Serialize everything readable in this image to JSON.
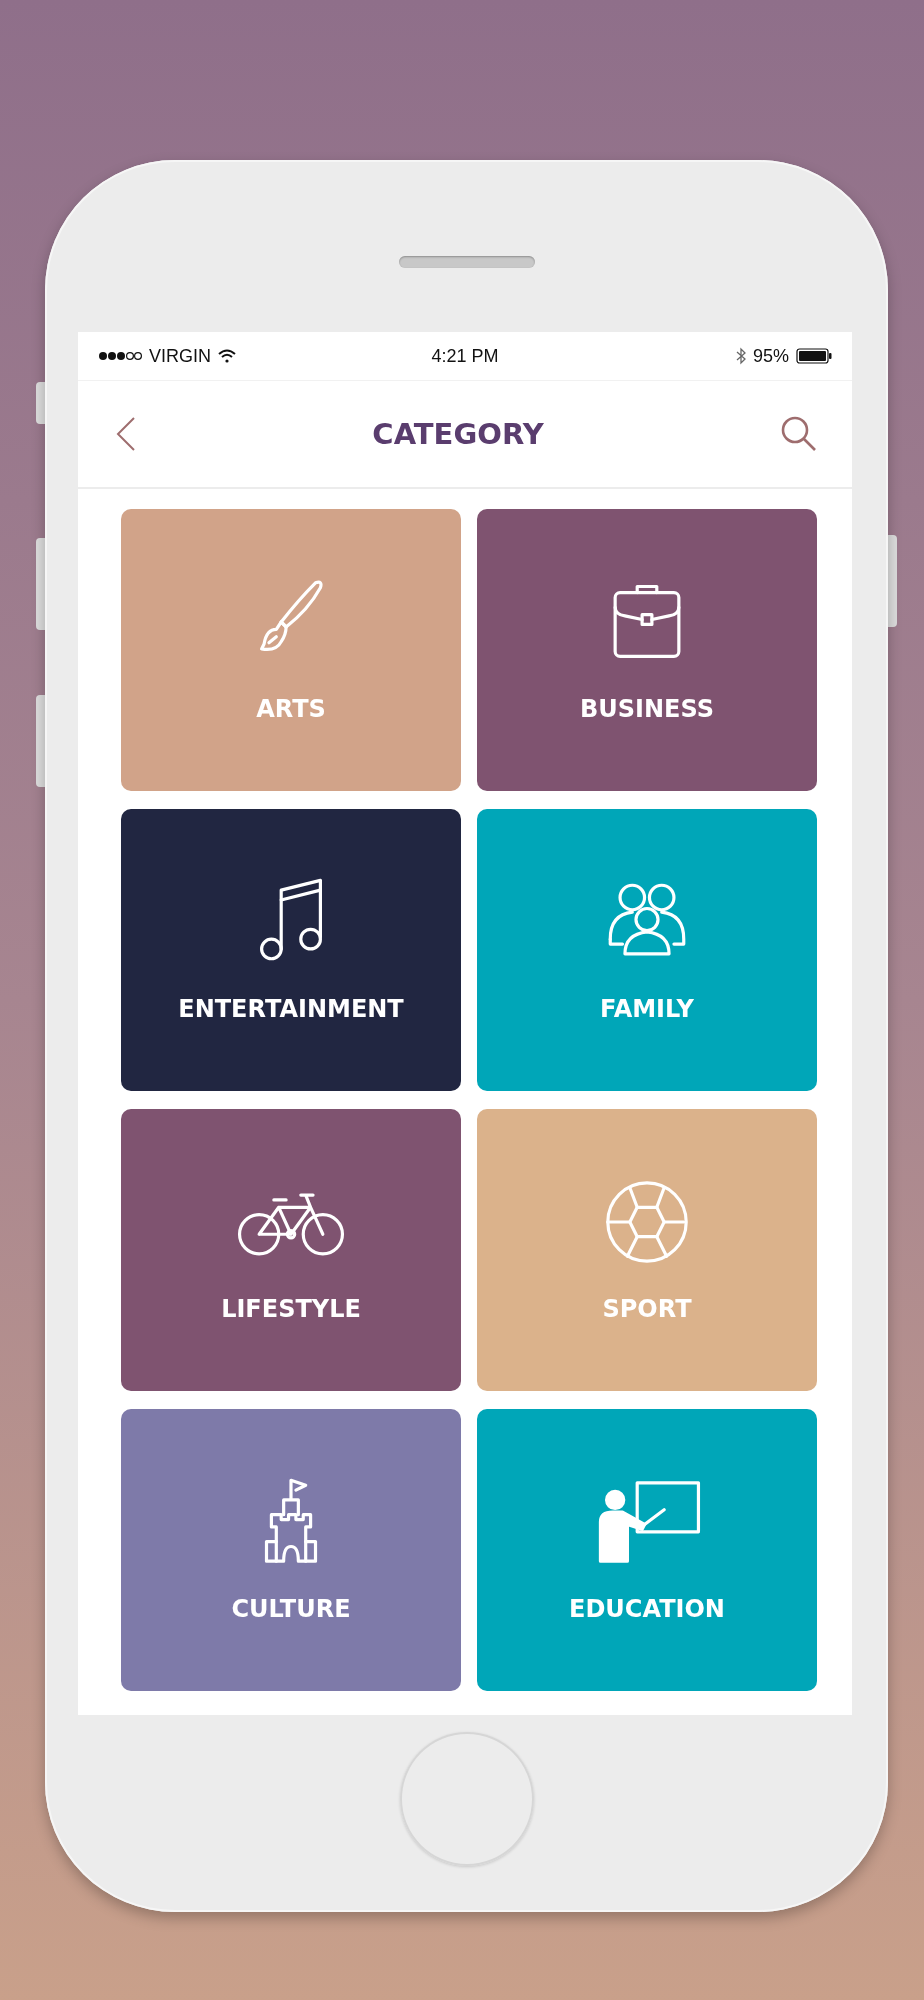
{
  "status_bar": {
    "carrier": "VIRGIN",
    "time": "4:21 PM",
    "battery": "95%"
  },
  "header": {
    "title": "CATEGORY"
  },
  "categories": [
    {
      "label": "ARTS",
      "kind": "brush",
      "color": "#d1a389"
    },
    {
      "label": "BUSINESS",
      "kind": "briefcase",
      "color": "#7f5370"
    },
    {
      "label": "ENTERTAINMENT",
      "kind": "music",
      "color": "#212641"
    },
    {
      "label": "FAMILY",
      "kind": "family",
      "color": "#00a6b8"
    },
    {
      "label": "LIFESTYLE",
      "kind": "bicycle",
      "color": "#7f5370"
    },
    {
      "label": "SPORT",
      "kind": "ball",
      "color": "#dbb28b"
    },
    {
      "label": "CULTURE",
      "kind": "castle",
      "color": "#7e7aa9"
    },
    {
      "label": "EDUCATION",
      "kind": "teacher",
      "color": "#00a6b8"
    }
  ]
}
